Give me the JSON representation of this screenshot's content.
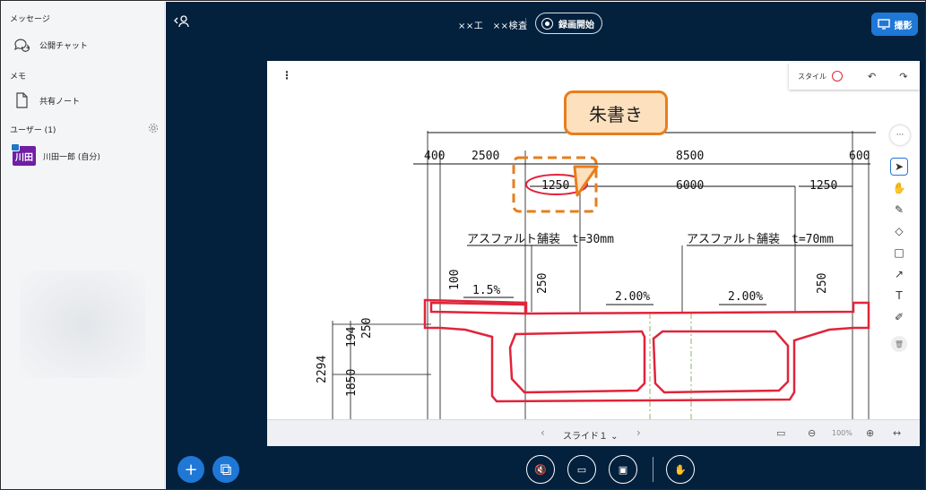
{
  "sidebar": {
    "messages_heading": "メッセージ",
    "public_chat": "公開チャット",
    "memo_heading": "メモ",
    "shared_note": "共有ノート",
    "users_heading": "ユーザー (1)",
    "user_avatar": "川田",
    "user_name": "川田一郎 (自分)"
  },
  "topbar": {
    "title": "××工　××検査",
    "record_label": "録画開始",
    "share_label": "撮影"
  },
  "toolbar": {
    "style_label": "スタイル",
    "style_color": "#e0243a"
  },
  "callout": {
    "text": "朱書き"
  },
  "slide_footer": {
    "slide_label": "スライド１ ⌄",
    "zoom": "100%"
  },
  "drawing": {
    "dims_top": [
      "400",
      "2500",
      "8500",
      "600"
    ],
    "dims_second": [
      "1250",
      "6000",
      "1250"
    ],
    "pavement_left": "アスファルト舗装　t=30mm",
    "pavement_right": "アスファルト舗装　t=70mm",
    "slope_left": "1.5%",
    "slope_center_left": "2.00%",
    "slope_center_right": "2.00%",
    "small_dims": [
      "100",
      "250",
      "250"
    ],
    "height_dims": [
      "2294",
      "194",
      "250",
      "1850"
    ]
  },
  "icons": {
    "chat": "chat-icon",
    "note": "note-icon",
    "gear": "gear-icon",
    "presenter": "presenter-icon",
    "monitor": "monitor-icon"
  },
  "colors": {
    "main_bg": "#03213d",
    "accent": "#1f77d6",
    "markup_red": "#e0243a",
    "callout_border": "#e77e1c",
    "callout_fill": "#fde0bd"
  }
}
